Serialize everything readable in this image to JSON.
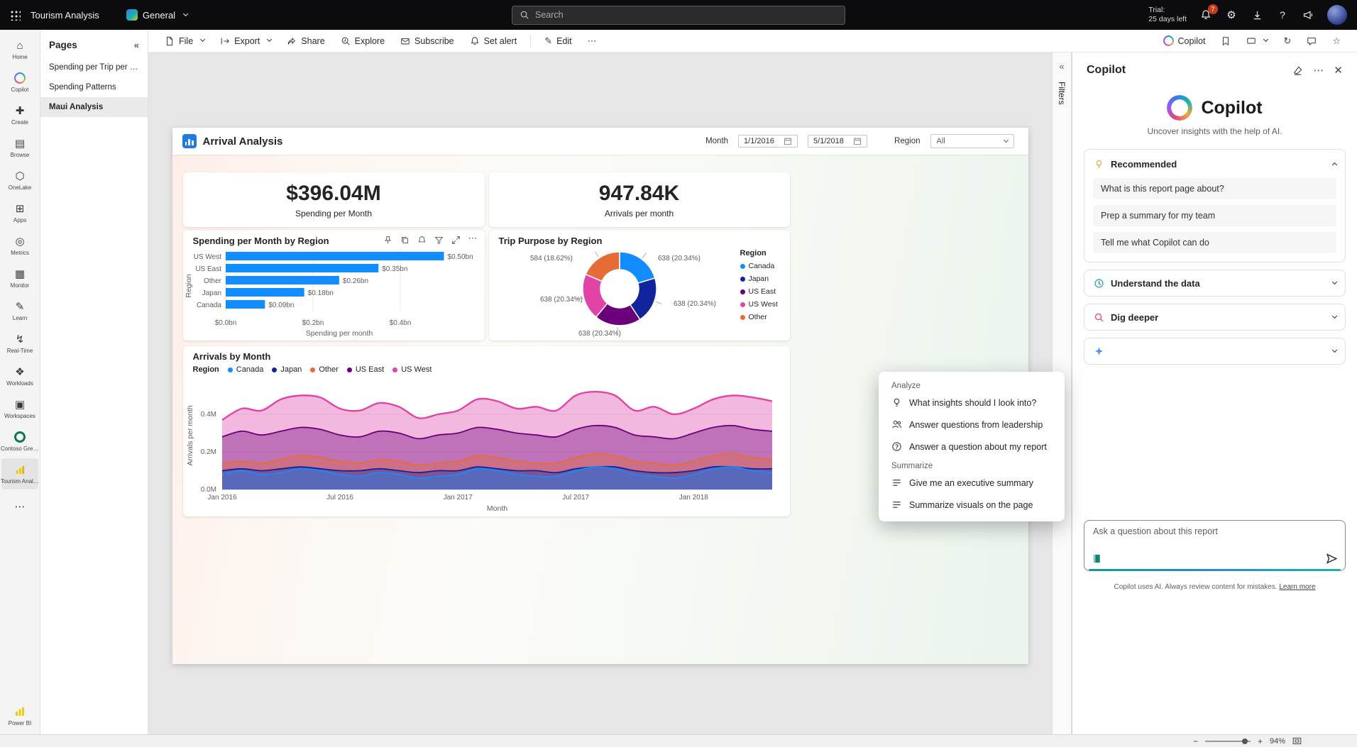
{
  "topbar": {
    "app_title": "Tourism Analysis",
    "workspace_label": "General",
    "search_placeholder": "Search",
    "trial_line1": "Trial:",
    "trial_line2": "25 days left",
    "notification_count": "7"
  },
  "left_rail": {
    "items": [
      {
        "label": "Home",
        "icon": "home-icon"
      },
      {
        "label": "Copilot",
        "icon": "copilot-icon"
      },
      {
        "label": "Create",
        "icon": "create-icon"
      },
      {
        "label": "Browse",
        "icon": "browse-icon"
      },
      {
        "label": "OneLake",
        "icon": "onelake-icon"
      },
      {
        "label": "Apps",
        "icon": "apps-icon"
      },
      {
        "label": "Metrics",
        "icon": "metrics-icon"
      },
      {
        "label": "Monitor",
        "icon": "monitor-icon"
      },
      {
        "label": "Learn",
        "icon": "learn-icon"
      },
      {
        "label": "Real-Time",
        "icon": "realtime-icon"
      },
      {
        "label": "Workloads",
        "icon": "workloads-icon"
      },
      {
        "label": "Workspaces",
        "icon": "workspaces-icon"
      },
      {
        "label": "Contoso Green -...",
        "icon": "contoso-icon"
      },
      {
        "label": "Tourism Analysis",
        "icon": "report-icon",
        "active": true
      },
      {
        "label": "",
        "icon": "more-icon"
      }
    ],
    "bottom_label": "Power BI"
  },
  "pages_panel": {
    "title": "Pages",
    "items": [
      "Spending per Trip per P...",
      "Spending Patterns",
      "Maui Analysis"
    ],
    "selected": "Maui Analysis"
  },
  "toolbar": {
    "file": "File",
    "export": "Export",
    "share": "Share",
    "explore": "Explore",
    "subscribe": "Subscribe",
    "set_alert": "Set alert",
    "edit": "Edit",
    "copilot_label": "Copilot"
  },
  "filters_pane": {
    "label": "Filters"
  },
  "report": {
    "title": "Arrival Analysis",
    "month_label": "Month",
    "date_from": "1/1/2016",
    "date_to": "5/1/2018",
    "region_label": "Region",
    "region_value": "All",
    "kpi1": {
      "value": "$396.04M",
      "label": "Spending per Month"
    },
    "kpi2": {
      "value": "947.84K",
      "label": "Arrivals per month"
    }
  },
  "chart_data": [
    {
      "type": "bar",
      "orientation": "horizontal",
      "title": "Spending per Month by Region",
      "categories": [
        "US West",
        "US East",
        "Other",
        "Japan",
        "Canada"
      ],
      "values": [
        0.5,
        0.35,
        0.26,
        0.18,
        0.09
      ],
      "data_labels": [
        "$0.50bn",
        "$0.35bn",
        "$0.26bn",
        "$0.18bn",
        "$0.09bn"
      ],
      "xlabel": "Spending per month",
      "ylabel": "Region",
      "xlim": [
        0,
        0.56
      ],
      "xticks": [
        0,
        0.2,
        0.4
      ],
      "xtick_labels": [
        "$0.0bn",
        "$0.2bn",
        "$0.4bn"
      ],
      "bar_color": "#118DFF"
    },
    {
      "type": "pie",
      "title": "Trip Purpose by Region",
      "legend_title": "Region",
      "legend_position": "right",
      "segments": [
        {
          "name": "Canada",
          "value": 638,
          "pct": "20.34%",
          "color": "#118DFF"
        },
        {
          "name": "Japan",
          "value": 638,
          "pct": "20.34%",
          "color": "#12239E"
        },
        {
          "name": "US East",
          "value": 638,
          "pct": "20.34%",
          "color": "#6B007B"
        },
        {
          "name": "US West",
          "value": 638,
          "pct": "20.34%",
          "color": "#E044A7"
        },
        {
          "name": "Other",
          "value": 584,
          "pct": "18.62%",
          "color": "#E66C37"
        }
      ]
    },
    {
      "type": "area",
      "title": "Arrivals by Month",
      "legend_title": "Region",
      "legend_position": "top",
      "xlabel": "Month",
      "ylabel": "Arrivals per month",
      "ylim": [
        0,
        0.57
      ],
      "yticks": [
        0,
        0.2,
        0.4
      ],
      "ytick_labels": [
        "0.0M",
        "0.2M",
        "0.4M"
      ],
      "x_tick_labels": [
        "Jan 2016",
        "Jul 2016",
        "Jan 2017",
        "Jul 2017",
        "Jan 2018"
      ],
      "x_tick_positions": [
        0,
        6,
        12,
        18,
        24
      ],
      "n_points": 29,
      "series": [
        {
          "name": "Canada",
          "color": "#118DFF",
          "values": [
            0.08,
            0.1,
            0.08,
            0.09,
            0.11,
            0.1,
            0.08,
            0.07,
            0.09,
            0.08,
            0.06,
            0.07,
            0.08,
            0.11,
            0.1,
            0.08,
            0.07,
            0.07,
            0.1,
            0.12,
            0.11,
            0.08,
            0.07,
            0.06,
            0.08,
            0.11,
            0.12,
            0.1,
            0.09
          ]
        },
        {
          "name": "Japan",
          "color": "#12239E",
          "values": [
            0.1,
            0.11,
            0.1,
            0.11,
            0.12,
            0.11,
            0.1,
            0.1,
            0.11,
            0.1,
            0.09,
            0.1,
            0.1,
            0.12,
            0.11,
            0.1,
            0.1,
            0.09,
            0.11,
            0.12,
            0.12,
            0.1,
            0.09,
            0.09,
            0.1,
            0.12,
            0.12,
            0.11,
            0.11
          ]
        },
        {
          "name": "Other",
          "color": "#E66C37",
          "values": [
            0.14,
            0.15,
            0.14,
            0.16,
            0.18,
            0.17,
            0.15,
            0.14,
            0.16,
            0.15,
            0.13,
            0.14,
            0.15,
            0.18,
            0.17,
            0.15,
            0.14,
            0.14,
            0.17,
            0.19,
            0.18,
            0.15,
            0.14,
            0.13,
            0.15,
            0.18,
            0.19,
            0.17,
            0.16
          ]
        },
        {
          "name": "US East",
          "color": "#6B007B",
          "values": [
            0.28,
            0.31,
            0.29,
            0.31,
            0.33,
            0.32,
            0.29,
            0.28,
            0.31,
            0.3,
            0.27,
            0.29,
            0.3,
            0.33,
            0.32,
            0.3,
            0.29,
            0.28,
            0.32,
            0.34,
            0.33,
            0.29,
            0.28,
            0.27,
            0.3,
            0.33,
            0.34,
            0.32,
            0.31
          ]
        },
        {
          "name": "US West",
          "color": "#E044A7",
          "values": [
            0.37,
            0.43,
            0.42,
            0.48,
            0.5,
            0.49,
            0.43,
            0.42,
            0.46,
            0.44,
            0.38,
            0.4,
            0.42,
            0.48,
            0.47,
            0.43,
            0.44,
            0.42,
            0.5,
            0.52,
            0.5,
            0.42,
            0.44,
            0.4,
            0.43,
            0.48,
            0.5,
            0.49,
            0.47
          ]
        }
      ]
    }
  ],
  "copilot": {
    "header_title": "Copilot",
    "hero_title": "Copilot",
    "subtitle": "Uncover insights with the help of AI.",
    "sections": [
      {
        "title": "Recommended",
        "icon": "lightbulb-icon",
        "expanded": true,
        "suggestions": [
          "What is this report page about?",
          "Prep a summary for my team",
          "Tell me what Copilot can do"
        ]
      },
      {
        "title": "Understand the data",
        "icon": "understand-icon",
        "expanded": false
      },
      {
        "title": "Dig deeper",
        "icon": "dig-deeper-icon",
        "expanded": false
      },
      {
        "title": "",
        "icon": "sparkle-icon",
        "expanded": false
      }
    ],
    "input_placeholder": "Ask a question about this report",
    "footer": "Copilot uses AI. Always review content for mistakes.",
    "footer_link": "Learn more"
  },
  "copilot_menu": {
    "groups": [
      {
        "title": "Analyze",
        "items": [
          {
            "label": "What insights should I look into?",
            "icon": "lightbulb-icon"
          },
          {
            "label": "Answer questions from leadership",
            "icon": "people-icon"
          },
          {
            "label": "Answer a question about my report",
            "icon": "question-circle-icon"
          }
        ]
      },
      {
        "title": "Summarize",
        "items": [
          {
            "label": "Give me an executive summary",
            "icon": "summary-lines-icon"
          },
          {
            "label": "Summarize visuals on the page",
            "icon": "summary-lines-icon"
          }
        ]
      }
    ]
  },
  "statusbar": {
    "zoom_label": "94%"
  }
}
